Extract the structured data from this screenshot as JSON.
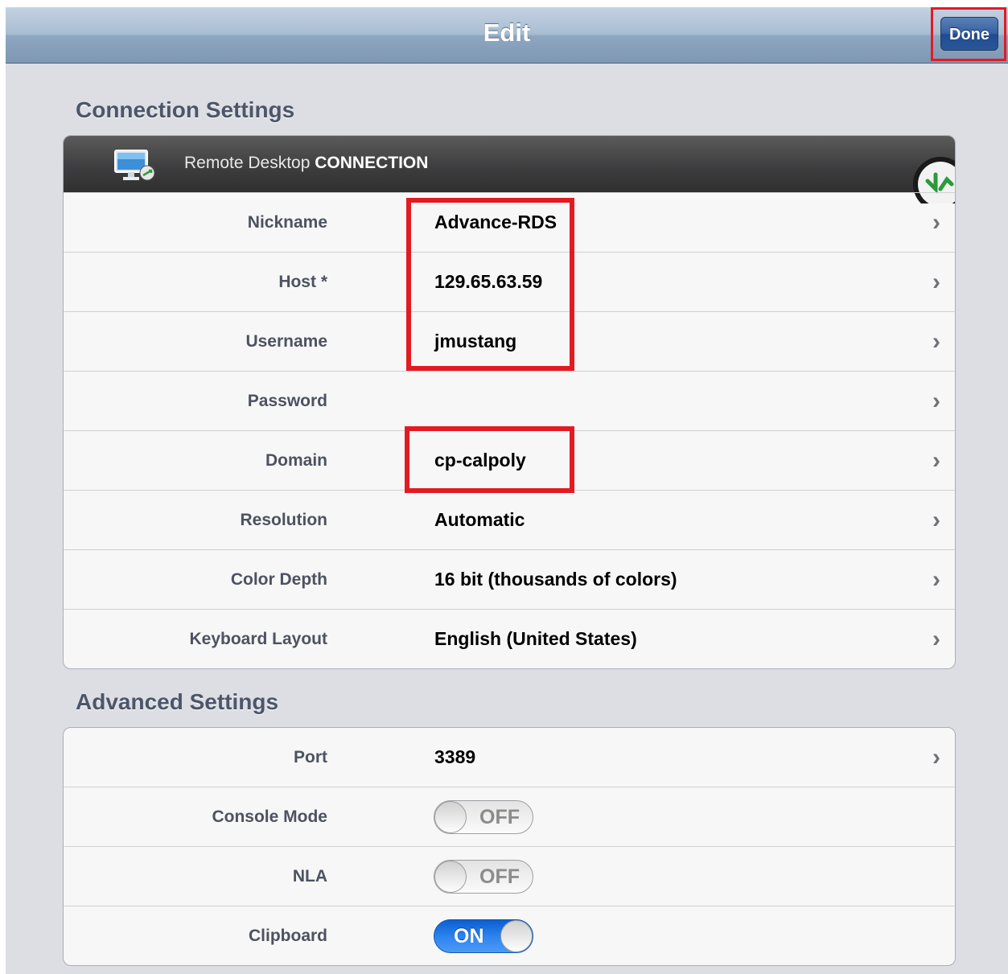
{
  "navbar": {
    "title": "Edit",
    "done_label": "Done"
  },
  "connection": {
    "section_title": "Connection Settings",
    "header": {
      "prefix": "Remote Desktop",
      "emphasis": "CONNECTION",
      "icon": "monitor-icon"
    },
    "rows": [
      {
        "label": "Nickname",
        "value": "Advance-RDS"
      },
      {
        "label": "Host *",
        "value": "129.65.63.59"
      },
      {
        "label": "Username",
        "value": "jmustang"
      },
      {
        "label": "Password",
        "value": ""
      },
      {
        "label": "Domain",
        "value": "cp-calpoly"
      },
      {
        "label": "Resolution",
        "value": "Automatic"
      },
      {
        "label": "Color Depth",
        "value": "16 bit (thousands of colors)"
      },
      {
        "label": "Keyboard Layout",
        "value": "English (United States)"
      }
    ]
  },
  "advanced": {
    "section_title": "Advanced Settings",
    "rows": [
      {
        "label": "Port",
        "value": "3389"
      },
      {
        "label": "Console Mode",
        "toggle": "OFF"
      },
      {
        "label": "NLA",
        "toggle": "OFF"
      },
      {
        "label": "Clipboard",
        "toggle": "ON"
      }
    ]
  },
  "chevron_glyph": "›",
  "colors": {
    "highlight": "#e21b23",
    "toggle_on": "#2f86f0",
    "done_button": "#2a5699"
  }
}
